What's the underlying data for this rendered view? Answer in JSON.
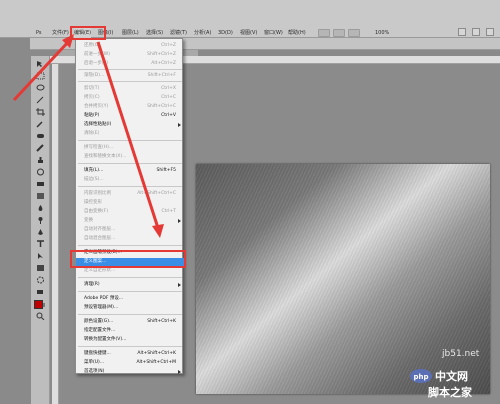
{
  "app": {
    "logo_text": "Ps"
  },
  "menubar": {
    "items": [
      {
        "label": "文件(F)"
      },
      {
        "label": "编辑(E)"
      },
      {
        "label": "图像(I)"
      },
      {
        "label": "图层(L)"
      },
      {
        "label": "选择(S)"
      },
      {
        "label": "滤镜(T)"
      },
      {
        "label": "分析(A)"
      },
      {
        "label": "3D(D)"
      },
      {
        "label": "视图(V)"
      },
      {
        "label": "窗口(W)"
      },
      {
        "label": "帮助(H)"
      }
    ],
    "zoom": "100%"
  },
  "edit_menu": {
    "items": [
      {
        "label": "还原(O)",
        "shortcut": "Ctrl+Z",
        "disabled": true
      },
      {
        "label": "前进一步(W)",
        "shortcut": "Shift+Ctrl+Z",
        "disabled": true
      },
      {
        "label": "后退一步(K)",
        "shortcut": "Alt+Ctrl+Z",
        "disabled": true
      },
      {
        "label": "渐隐(D)...",
        "shortcut": "Shift+Ctrl+F",
        "disabled": true
      },
      {
        "label": "剪切(T)",
        "shortcut": "Ctrl+X",
        "disabled": true
      },
      {
        "label": "拷贝(C)",
        "shortcut": "Ctrl+C",
        "disabled": true
      },
      {
        "label": "合并拷贝(Y)",
        "shortcut": "Shift+Ctrl+C",
        "disabled": true
      },
      {
        "label": "粘贴(P)",
        "shortcut": "Ctrl+V",
        "disabled": false
      },
      {
        "label": "选择性粘贴(I)",
        "shortcut": "",
        "disabled": false,
        "submenu": true
      },
      {
        "label": "清除(E)",
        "shortcut": "",
        "disabled": true
      },
      {
        "label": "拼写检查(H)...",
        "shortcut": "",
        "disabled": true
      },
      {
        "label": "查找和替换文本(X)...",
        "shortcut": "",
        "disabled": true
      },
      {
        "label": "填充(L)...",
        "shortcut": "Shift+F5",
        "disabled": false
      },
      {
        "label": "描边(S)...",
        "shortcut": "",
        "disabled": true
      },
      {
        "label": "内容识别比例",
        "shortcut": "Alt+Shift+Ctrl+C",
        "disabled": true
      },
      {
        "label": "操控变形",
        "shortcut": "",
        "disabled": true
      },
      {
        "label": "自由变换(F)",
        "shortcut": "Ctrl+T",
        "disabled": true
      },
      {
        "label": "变换",
        "shortcut": "",
        "disabled": true,
        "submenu": true
      },
      {
        "label": "自动对齐图层...",
        "shortcut": "",
        "disabled": true
      },
      {
        "label": "自动混合图层...",
        "shortcut": "",
        "disabled": true
      },
      {
        "label": "定义画笔预设(B)...",
        "shortcut": "",
        "disabled": false
      },
      {
        "label": "定义图案...",
        "shortcut": "",
        "disabled": false,
        "selected": true
      },
      {
        "label": "定义自定形状...",
        "shortcut": "",
        "disabled": true
      },
      {
        "label": "清理(R)",
        "shortcut": "",
        "disabled": false,
        "submenu": true
      },
      {
        "label": "Adobe PDF 预设...",
        "shortcut": "",
        "disabled": false
      },
      {
        "label": "预设管理器(M)...",
        "shortcut": "",
        "disabled": false
      },
      {
        "label": "颜色设置(G)...",
        "shortcut": "Shift+Ctrl+K",
        "disabled": false
      },
      {
        "label": "指定配置文件...",
        "shortcut": "",
        "disabled": false
      },
      {
        "label": "转换为配置文件(V)...",
        "shortcut": "",
        "disabled": false
      },
      {
        "label": "键盘快捷键...",
        "shortcut": "Alt+Shift+Ctrl+K",
        "disabled": false
      },
      {
        "label": "菜单(U)...",
        "shortcut": "Alt+Shift+Ctrl+M",
        "disabled": false
      },
      {
        "label": "首选项(N)",
        "shortcut": "",
        "disabled": false,
        "submenu": true
      }
    ]
  },
  "watermark": {
    "site": "jb51.net",
    "brand": "php中文网",
    "sub": "脚本之家"
  },
  "colors": {
    "annotation": "#e53935",
    "highlight": "#3a8ee6",
    "foreground": "#c00000"
  }
}
